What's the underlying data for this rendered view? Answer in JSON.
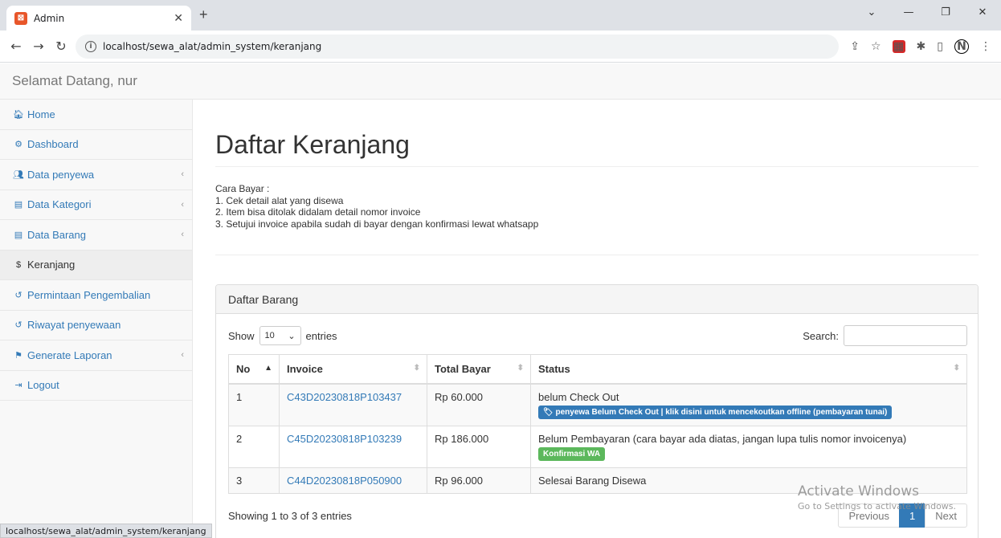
{
  "browser": {
    "tab_title": "Admin",
    "url": "localhost/sewa_alat/admin_system/keranjang",
    "status_url": "localhost/sewa_alat/admin_system/keranjang"
  },
  "header": {
    "brand": "Selamat Datang, nur"
  },
  "sidebar": {
    "items": [
      {
        "label": "Home",
        "icon": "home-icon"
      },
      {
        "label": "Dashboard",
        "icon": "dashboard-icon"
      },
      {
        "label": "Data penyewa",
        "icon": "users-icon"
      },
      {
        "label": "Data Kategori",
        "icon": "list-icon"
      },
      {
        "label": "Data Barang",
        "icon": "list-icon"
      },
      {
        "label": "Keranjang",
        "icon": "dollar-icon"
      },
      {
        "label": "Permintaan Pengembalian",
        "icon": "undo-icon"
      },
      {
        "label": "Riwayat penyewaan",
        "icon": "undo-icon"
      },
      {
        "label": "Generate Laporan",
        "icon": "flag-icon"
      },
      {
        "label": "Logout",
        "icon": "signout-icon"
      }
    ]
  },
  "main": {
    "title": "Daftar Keranjang",
    "instructions": {
      "heading": "Cara Bayar :",
      "steps": [
        "1. Cek detail alat yang disewa",
        "2. Item bisa ditolak didalam detail nomor invoice",
        "3. Setujui invoice apabila sudah di bayar dengan konfirmasi lewat whatsapp"
      ]
    },
    "panel_title": "Daftar Barang",
    "show_label": "Show",
    "entries_value": "10",
    "entries_label": "entries",
    "search_label": "Search:",
    "columns": [
      "No",
      "Invoice",
      "Total Bayar",
      "Status"
    ],
    "rows": [
      {
        "no": "1",
        "invoice": "C43D20230818P103437",
        "total": "Rp 60.000",
        "status": "belum Check Out",
        "badge": "penyewa Belum Check Out | klik disini untuk mencekoutkan offline (pembayaran tunai)"
      },
      {
        "no": "2",
        "invoice": "C45D20230818P103239",
        "total": "Rp 186.000",
        "status": "Belum Pembayaran (cara bayar ada diatas, jangan lupa tulis nomor invoicenya)",
        "badge": "Konfirmasi WA"
      },
      {
        "no": "3",
        "invoice": "C44D20230818P050900",
        "total": "Rp 96.000",
        "status": "Selesai Barang Disewa"
      }
    ],
    "info": "Showing 1 to 3 of 3 entries",
    "pager": {
      "previous": "Previous",
      "current": "1",
      "next": "Next"
    }
  },
  "watermark": {
    "line1": "Activate Windows",
    "line2": "Go to Settings to activate Windows."
  }
}
